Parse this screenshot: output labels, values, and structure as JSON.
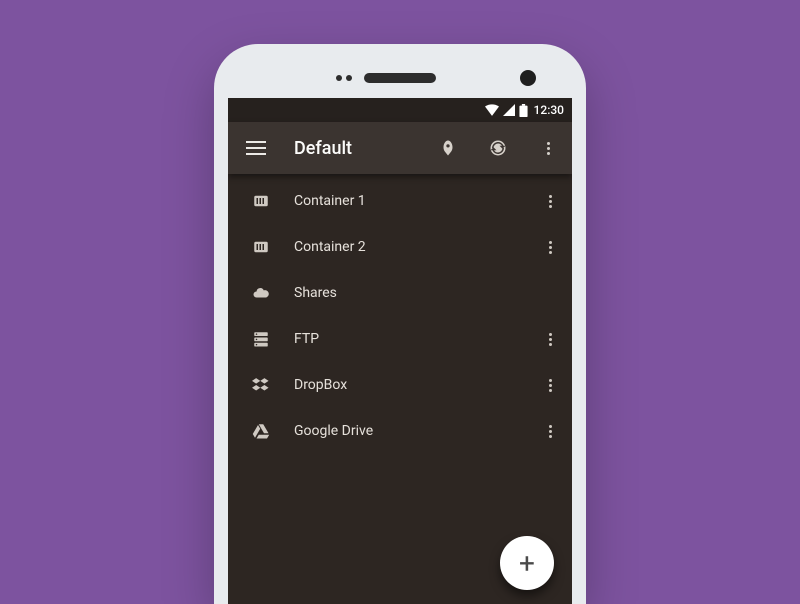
{
  "statusbar": {
    "time": "12:30"
  },
  "appbar": {
    "title": "Default"
  },
  "items": [
    {
      "label": "Container 1",
      "icon": "container",
      "menu": true
    },
    {
      "label": "Container 2",
      "icon": "container",
      "menu": true
    },
    {
      "label": "Shares",
      "icon": "cloud",
      "menu": false
    },
    {
      "label": "FTP",
      "icon": "server",
      "menu": true
    },
    {
      "label": "DropBox",
      "icon": "dropbox",
      "menu": true
    },
    {
      "label": "Google Drive",
      "icon": "gdrive",
      "menu": true
    }
  ],
  "fab": {
    "glyph": "+"
  }
}
